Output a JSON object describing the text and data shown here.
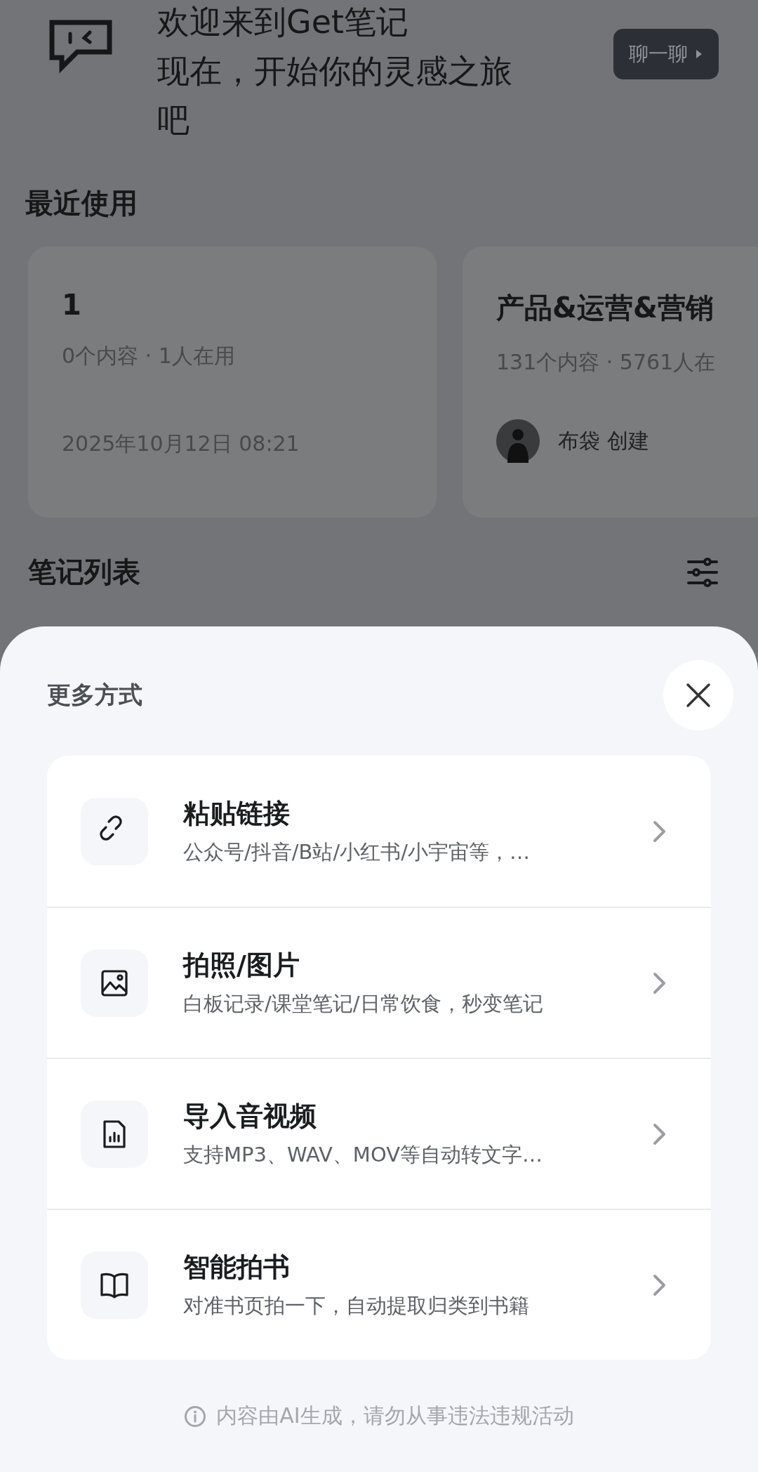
{
  "header": {
    "title": "欢迎来到Get笔记",
    "subtitle": "现在，开始你的灵感之旅吧",
    "chat_button": "聊一聊"
  },
  "recent": {
    "title": "最近使用",
    "cards": [
      {
        "kind": "date",
        "title": "1",
        "meta": "0个内容 · 1人在用",
        "footer": "2025年10月12日 08:21"
      },
      {
        "kind": "creator",
        "title": "产品&运营&营销",
        "meta": "131个内容 · 5761人在",
        "footer": "布袋 创建"
      }
    ]
  },
  "notes": {
    "title": "笔记列表"
  },
  "sheet": {
    "title": "更多方式",
    "options": [
      {
        "kind": "link",
        "title": "粘贴链接",
        "description": "公众号/抖音/B站/小红书/小宇宙等，…"
      },
      {
        "kind": "image",
        "title": "拍照/图片",
        "description": "白板记录/课堂笔记/日常饮食，秒变笔记"
      },
      {
        "kind": "audio",
        "title": "导入音视频",
        "description": "支持MP3、WAV、MOV等自动转文字…"
      },
      {
        "kind": "book",
        "title": "智能拍书",
        "description": "对准书页拍一下，自动提取归类到书籍"
      }
    ],
    "footer": "内容由AI生成，请勿从事违法违规活动"
  }
}
